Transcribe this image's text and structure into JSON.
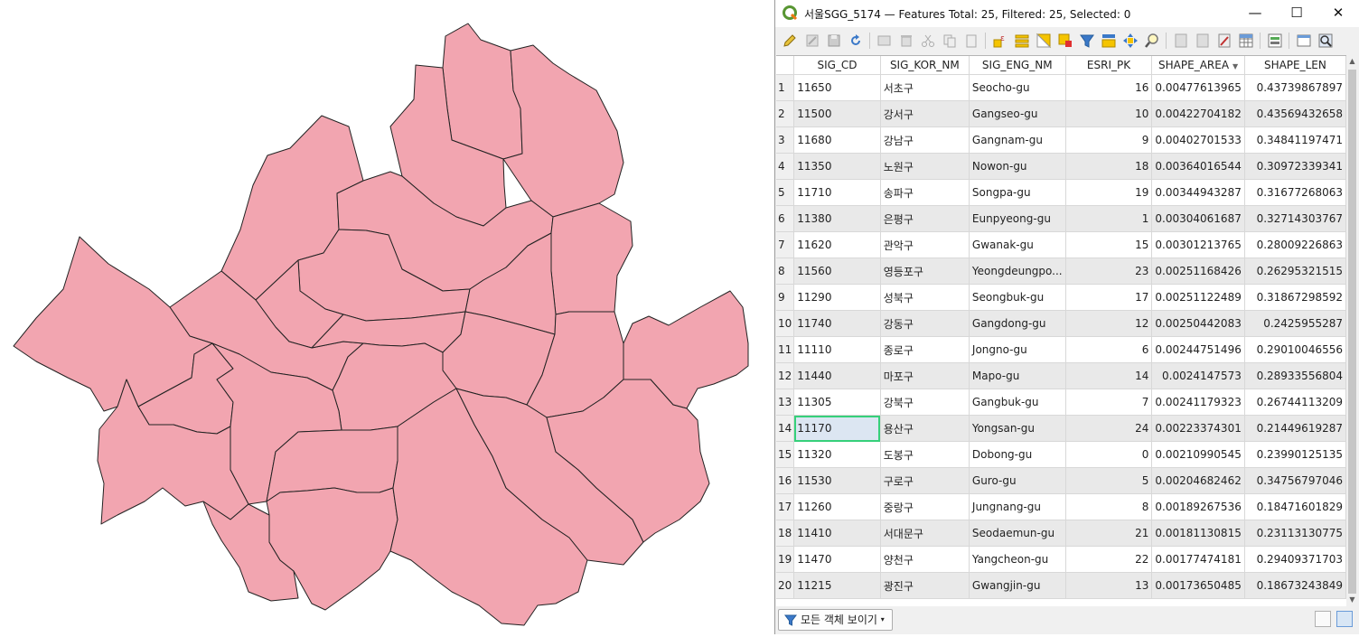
{
  "window": {
    "title": "서울SGG_5174 — Features Total: 25, Filtered: 25, Selected: 0",
    "minimize_glyph": "—",
    "maximize_glyph": "☐",
    "close_glyph": "✕"
  },
  "toolbar": {
    "icons": [
      "toggle-editing-icon",
      "multi-edit-icon",
      "save-edits-icon",
      "reload-icon",
      "add-feature-icon",
      "delete-feature-icon",
      "cut-icon",
      "copy-icon",
      "paste-icon",
      "expression-select-icon",
      "select-all-icon",
      "invert-selection-icon",
      "deselect-all-icon",
      "filter-select-icon",
      "move-selection-top-icon",
      "pan-to-selection-icon",
      "zoom-to-selection-icon",
      "new-field-icon",
      "delete-field-icon",
      "organize-columns-icon",
      "field-calculator-icon",
      "conditional-formatting-icon",
      "dock-icon",
      "actions-icon"
    ]
  },
  "table": {
    "columns": [
      "SIG_CD",
      "SIG_KOR_NM",
      "SIG_ENG_NM",
      "ESRI_PK",
      "SHAPE_AREA",
      "SHAPE_LEN"
    ],
    "sorted_column": "SHAPE_AREA",
    "rows": [
      [
        "1",
        "11650",
        "서초구",
        "Seocho-gu",
        "16",
        "0.00477613965",
        "0.43739867897"
      ],
      [
        "2",
        "11500",
        "강서구",
        "Gangseo-gu",
        "10",
        "0.00422704182",
        "0.43569432658"
      ],
      [
        "3",
        "11680",
        "강남구",
        "Gangnam-gu",
        "9",
        "0.00402701533",
        "0.34841197471"
      ],
      [
        "4",
        "11350",
        "노원구",
        "Nowon-gu",
        "18",
        "0.00364016544",
        "0.30972339341"
      ],
      [
        "5",
        "11710",
        "송파구",
        "Songpa-gu",
        "19",
        "0.00344943287",
        "0.31677268063"
      ],
      [
        "6",
        "11380",
        "은평구",
        "Eunpyeong-gu",
        "1",
        "0.00304061687",
        "0.32714303767"
      ],
      [
        "7",
        "11620",
        "관악구",
        "Gwanak-gu",
        "15",
        "0.00301213765",
        "0.28009226863"
      ],
      [
        "8",
        "11560",
        "영등포구",
        "Yeongdeungpo...",
        "23",
        "0.00251168426",
        "0.26295321515"
      ],
      [
        "9",
        "11290",
        "성북구",
        "Seongbuk-gu",
        "17",
        "0.00251122489",
        "0.31867298592"
      ],
      [
        "10",
        "11740",
        "강동구",
        "Gangdong-gu",
        "12",
        "0.00250442083",
        "0.2425955287"
      ],
      [
        "11",
        "11110",
        "종로구",
        "Jongno-gu",
        "6",
        "0.00244751496",
        "0.29010046556"
      ],
      [
        "12",
        "11440",
        "마포구",
        "Mapo-gu",
        "14",
        "0.0024147573",
        "0.28933556804"
      ],
      [
        "13",
        "11305",
        "강북구",
        "Gangbuk-gu",
        "7",
        "0.00241179323",
        "0.26744113209"
      ],
      [
        "14",
        "11170",
        "용산구",
        "Yongsan-gu",
        "24",
        "0.00223374301",
        "0.21449619287"
      ],
      [
        "15",
        "11320",
        "도봉구",
        "Dobong-gu",
        "0",
        "0.00210990545",
        "0.23990125135"
      ],
      [
        "16",
        "11530",
        "구로구",
        "Guro-gu",
        "5",
        "0.00204682462",
        "0.34756797046"
      ],
      [
        "17",
        "11260",
        "중랑구",
        "Jungnang-gu",
        "8",
        "0.00189267536",
        "0.18471601829"
      ],
      [
        "18",
        "11410",
        "서대문구",
        "Seodaemun-gu",
        "21",
        "0.00181130815",
        "0.23113130775"
      ],
      [
        "19",
        "11470",
        "양천구",
        "Yangcheon-gu",
        "22",
        "0.00177474181",
        "0.29409371703"
      ],
      [
        "20",
        "11215",
        "광진구",
        "Gwangjin-gu",
        "13",
        "0.00173650485",
        "0.18673243849"
      ]
    ]
  },
  "statusbar": {
    "show_all_label": "모든 객체 보이기"
  },
  "map": {
    "fill_color": "#f2a5b0",
    "stroke_color": "#222222"
  }
}
